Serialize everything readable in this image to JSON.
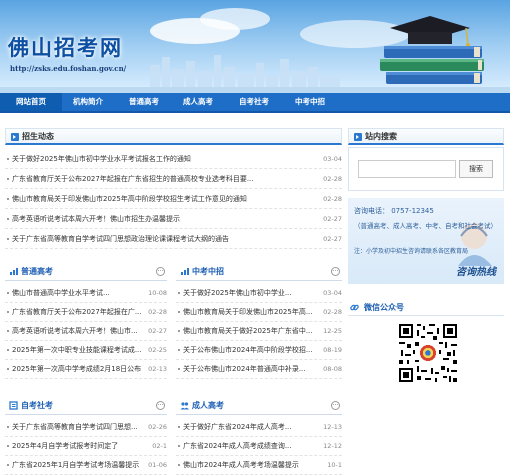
{
  "site": {
    "title": "佛山招考网",
    "url": "http://zsks.edu.foshan.gov.cn/"
  },
  "nav": [
    "网站首页",
    "机构简介",
    "普通高考",
    "成人高考",
    "自考社考",
    "中考中招"
  ],
  "main": {
    "heading": "招生动态",
    "items": [
      {
        "title": "关于做好2025年佛山市初中学业水平考试报名工作的通知",
        "date": "03-04"
      },
      {
        "title": "广东省教育厅关于公布2027年起报在广东省招生的普通高校专业选考科目要...",
        "date": "02-28"
      },
      {
        "title": "佛山市教育局关于印发佛山市2025年高中阶段学校招生考试工作意见的通知",
        "date": "02-28"
      },
      {
        "title": "高考英语听说考试本周六开考！佛山市招生办温馨提示",
        "date": "02-27"
      },
      {
        "title": "关于广东省高等教育自学考试四门思想政治理论课课程考试大纲的通告",
        "date": "02-27"
      }
    ]
  },
  "sections": [
    {
      "title": "普通高考",
      "items": [
        {
          "title": "佛山市普通高中学业水平考试...",
          "date": "10-08"
        },
        {
          "title": "广东省教育厅关于公布2027年起报在广...",
          "date": "02-28"
        },
        {
          "title": "高考英语听说考试本周六开考！佛山市...",
          "date": "02-27"
        },
        {
          "title": "2025年第一次中职专业技能课程考试成...",
          "date": "02-25"
        },
        {
          "title": "2025年第一次高中学考成绩2月18日公布",
          "date": "02-13"
        }
      ]
    },
    {
      "title": "中考中招",
      "items": [
        {
          "title": "关于做好2025年佛山市初中学业...",
          "date": "03-04"
        },
        {
          "title": "佛山市教育局关于印发佛山市2025年高...",
          "date": "02-28"
        },
        {
          "title": "佛山市教育局关于做好2025年广东省中...",
          "date": "12-25"
        },
        {
          "title": "关于公布佛山市2024年高中阶段学校招...",
          "date": "08-19"
        },
        {
          "title": "关于公布佛山市2024年普通高中补录...",
          "date": "08-08"
        }
      ]
    },
    {
      "title": "自考社考",
      "items": [
        {
          "title": "关于广东省高等教育自学考试四门思想...",
          "date": "02-26"
        },
        {
          "title": "2025年4月自学考试报考时间定了",
          "date": "02-1"
        },
        {
          "title": "广东省2025年1月自学考试考场温馨提示",
          "date": "01-06"
        }
      ]
    },
    {
      "title": "成人高考",
      "items": [
        {
          "title": "关于做好广东省2024年成人高考...",
          "date": "12-13"
        },
        {
          "title": "广东省2024年成人高考成绩查询...",
          "date": "12-12"
        },
        {
          "title": "佛山市2024年成人高考考场温馨提示",
          "date": "10-1"
        }
      ]
    }
  ],
  "search": {
    "heading": "站内搜索",
    "button": "搜索",
    "placeholder": ""
  },
  "hotline": {
    "phone": "咨询电话： 0757-12345",
    "scope": "（普通高考、成人高考、中考、自考和社会考试）",
    "note": "注：小学及初中招生咨询请联系各区教育局",
    "label": "咨询热线"
  },
  "wechat": {
    "heading": "微信公众号"
  },
  "colors": {
    "nav": "#1e6ec7",
    "accent": "#2a78cf",
    "title": "#0d4fa3"
  }
}
